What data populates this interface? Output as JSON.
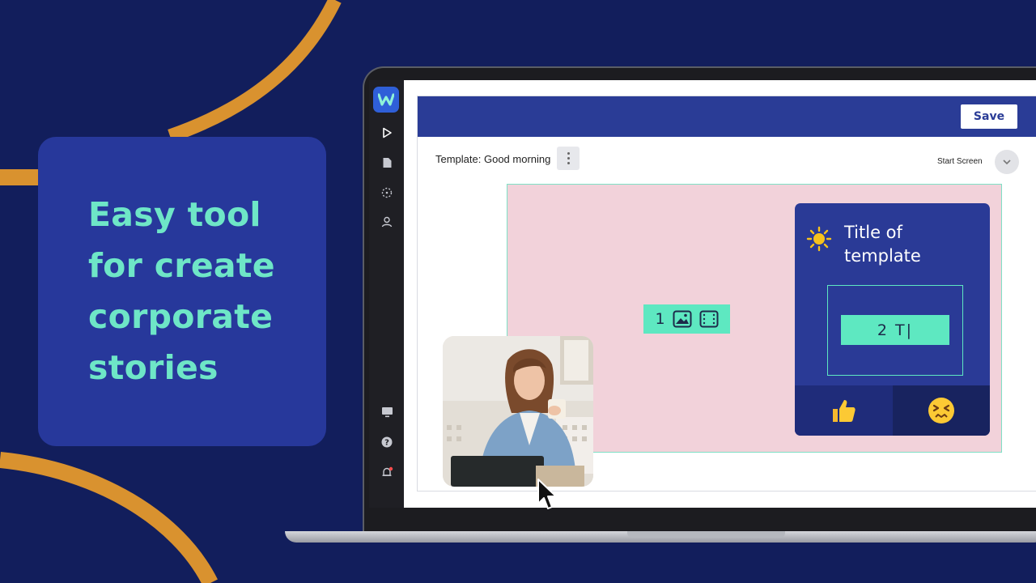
{
  "colors": {
    "background": "#121e5c",
    "arc": "#d9922f",
    "promo_card": "#27389b",
    "accent": "#6ee6c7",
    "editor_header": "#2a3c96",
    "canvas": "#f2d2da",
    "placeholder": "#5ee8c1"
  },
  "promo": {
    "headline": "Easy tool\nfor create\ncorporate\nstories"
  },
  "app_rail": {
    "logo_icon": "w-logo-icon",
    "top_icons": [
      "play-icon",
      "document-icon",
      "dashed-circle-icon",
      "user-icon"
    ],
    "bottom_icons": [
      "monitor-icon",
      "help-icon",
      "bell-icon"
    ]
  },
  "editor": {
    "save_label": "Save",
    "template_label": "Template: Good morning",
    "screen_select_label": "Start Screen"
  },
  "canvas": {
    "media_placeholder_number": "1",
    "template_card": {
      "title": "Title of\ntemplate",
      "text_placeholder": "2 T|",
      "reactions": [
        "👍",
        "😣"
      ]
    }
  }
}
